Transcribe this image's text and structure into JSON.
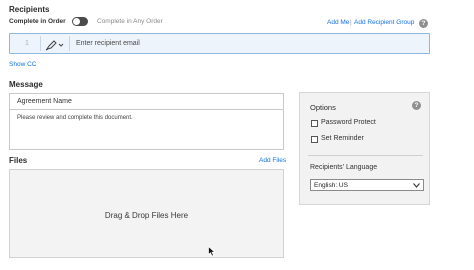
{
  "recipients": {
    "title": "Recipients",
    "complete_in_order_label": "Complete in Order",
    "complete_in_any_order_label": "Complete in Any Order",
    "add_me_label": "Add Me",
    "add_recipient_group_label": "Add Recipient Group",
    "row_number": "1",
    "email_placeholder": "Enter recipient email",
    "show_cc_label": "Show CC"
  },
  "message": {
    "title": "Message",
    "agreement_name_placeholder": "Agreement Name",
    "body_text": "Please review and complete this document."
  },
  "files": {
    "title": "Files",
    "add_files_label": "Add Files",
    "dropzone_text": "Drag & Drop Files Here"
  },
  "options": {
    "title": "Options",
    "password_protect_label": "Password Protect",
    "set_reminder_label": "Set Reminder",
    "recipients_language_label": "Recipients' Language",
    "language_selected": "English: US"
  },
  "colors": {
    "accent": "#1473e6",
    "toggle_off": "#4b4b4b",
    "recipient_row_bg": "#eef4fb"
  }
}
